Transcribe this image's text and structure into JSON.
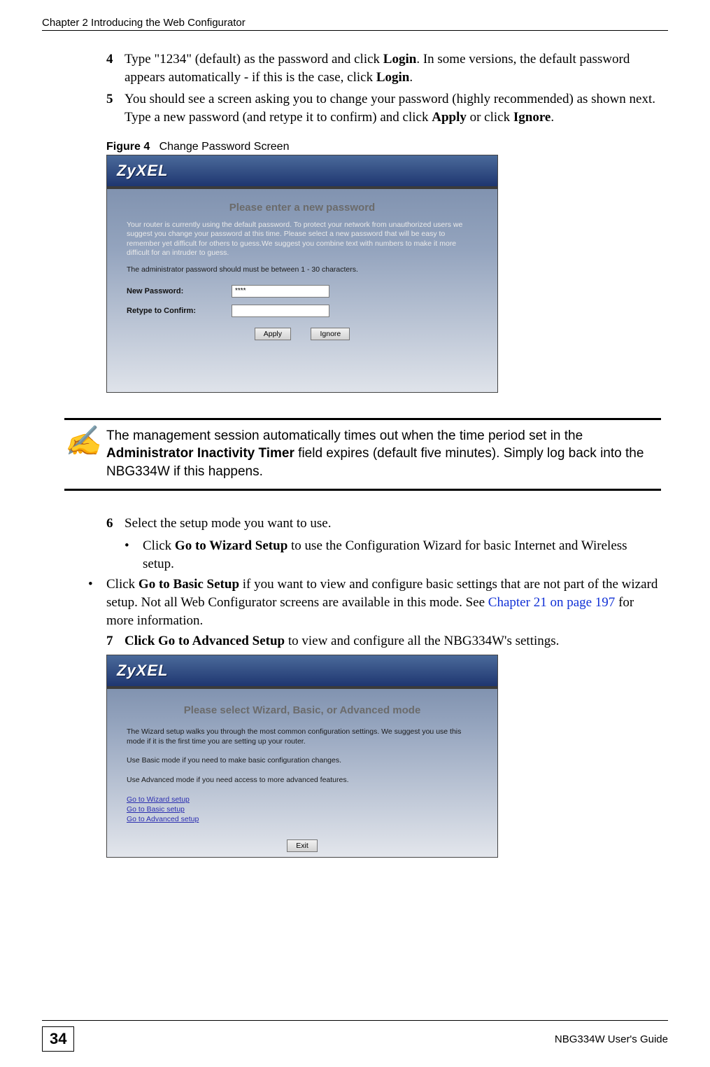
{
  "header": {
    "chapter": "Chapter 2 Introducing the Web Configurator"
  },
  "steps_a": [
    {
      "num": "4",
      "html": "Type \"1234\" (default) as the password and click <b>Login</b>. In some versions, the default password appears automatically - if this is the case, click <b>Login</b>."
    },
    {
      "num": "5",
      "html": "You should see a screen asking you to change your password (highly recommended) as shown next. Type a new password (and retype it to confirm) and click <b>Apply</b> or click <b>Ignore</b>."
    }
  ],
  "figure4": {
    "label": "Figure 4",
    "caption": "Change Password Screen"
  },
  "shot1": {
    "logo": "ZyXEL",
    "title": "Please enter a new password",
    "para1": "Your router is currently using the default password. To protect your network from unauthorized users we suggest you change your password at this time. Please select a new password that will be easy to remember yet difficult for others to guess.We suggest you combine text with numbers to make it more difficult for an intruder to guess.",
    "para2": "The administrator password should must be between 1 - 30 characters.",
    "new_pw_label": "New Password:",
    "new_pw_value": "****",
    "retype_label": "Retype to Confirm:",
    "retype_value": "",
    "apply": "Apply",
    "ignore": "Ignore"
  },
  "note": {
    "html": "The management session automatically times out when the time period set in the <b>Administrator Inactivity Timer</b> field expires (default five minutes). Simply log back into the NBG334W if this happens."
  },
  "steps_b": {
    "num6": "6",
    "text6": "Select the setup mode you want to use.",
    "bullet6a_html": "Click <b>Go to Wizard Setup</b> to use the Configuration Wizard for basic Internet and Wireless setup.",
    "bullet6b_prefix": "Click ",
    "bullet6b_bold": "Go to Basic Setup",
    "bullet6b_mid": " if you want to view and configure basic settings that are not part of the wizard setup. Not all Web Configurator screens are available in this mode. See ",
    "bullet6b_link": "Chapter 21 on page 197",
    "bullet6b_suffix": " for more information.",
    "num7": "7",
    "text7_html": "<b>Click Go to Advanced Setup</b> to view and configure all the NBG334W's settings."
  },
  "shot2": {
    "logo": "ZyXEL",
    "title": "Please select Wizard, Basic, or Advanced mode",
    "para1": "The Wizard setup walks you through the most common configuration settings. We suggest you use this mode if it is the first time you are setting up your router.",
    "para2": "Use Basic mode if you need to make basic configuration changes.",
    "para3": "Use Advanced mode if you need access to more advanced features.",
    "link_wizard": "Go to Wizard setup",
    "link_basic": "Go to Basic setup",
    "link_advanced": "Go to Advanced setup",
    "exit": "Exit"
  },
  "footer": {
    "page": "34",
    "guide": "NBG334W User's Guide"
  }
}
